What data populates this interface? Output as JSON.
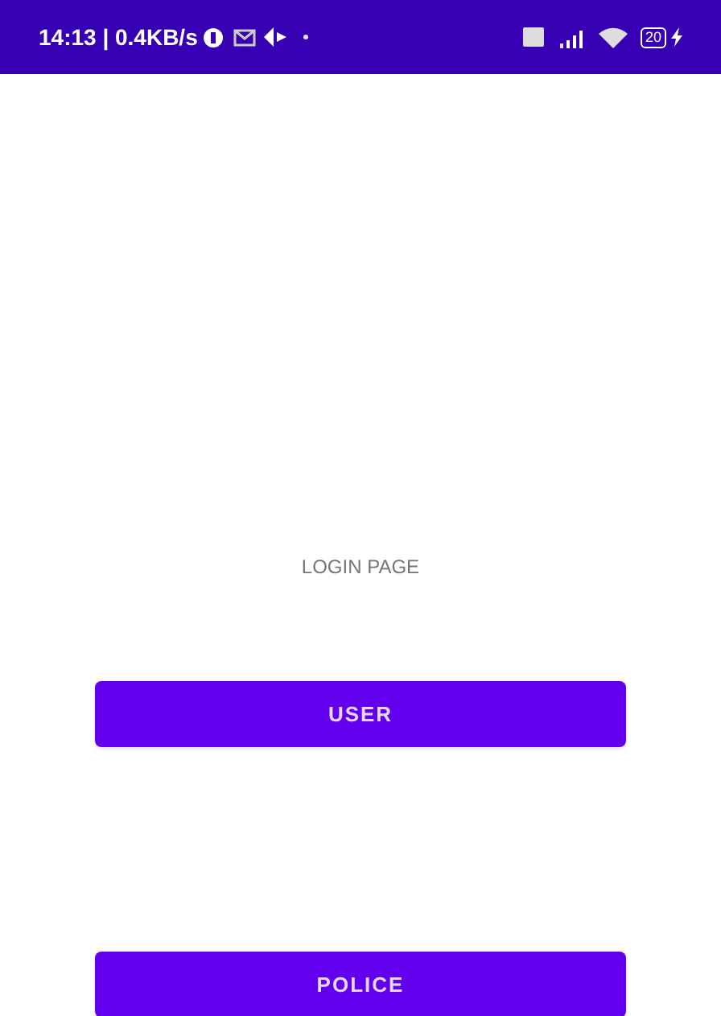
{
  "status_bar": {
    "time_speed": "14:13 | 0.4KB/s",
    "battery": "20"
  },
  "title": "LOGIN PAGE",
  "buttons": [
    {
      "label": "USER"
    },
    {
      "label": "POLICE"
    }
  ]
}
